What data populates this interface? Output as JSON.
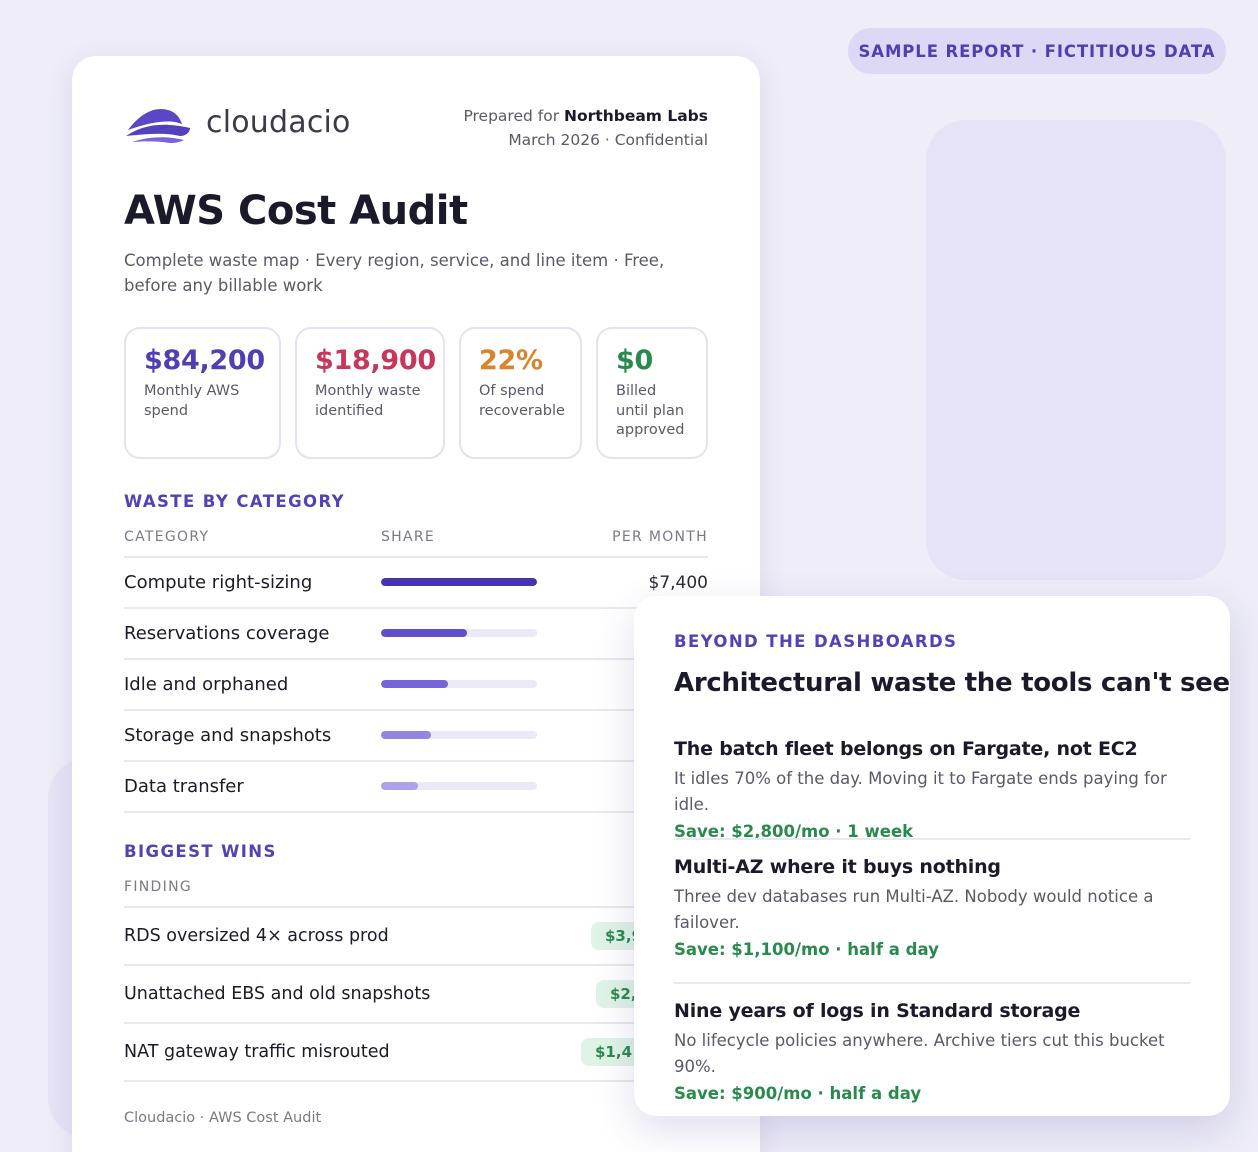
{
  "badge": {
    "label": "SAMPLE REPORT · FICTITIOUS DATA"
  },
  "brand": {
    "name": "cloudacio",
    "logo_icon": "cloudacio-wave-logo"
  },
  "prepared": {
    "prefix": "Prepared for",
    "client": "Northbeam Labs",
    "line2": "March 2026 · Confidential"
  },
  "report": {
    "title": "AWS Cost Audit",
    "subtitle": "Complete waste map · Every region, service, and line item · Free, before any billable work"
  },
  "stats": [
    {
      "value": "$84,200",
      "label": "Monthly AWS spend",
      "color": "#4f3fb3"
    },
    {
      "value": "$18,900",
      "label": "Monthly waste identified",
      "color": "#c8365b"
    },
    {
      "value": "22%",
      "label": "Of spend recoverable",
      "color": "#d9842a"
    },
    {
      "value": "$0",
      "label": "Billed until plan approved",
      "color": "#2a8a4e"
    }
  ],
  "waste": {
    "heading": "WASTE BY CATEGORY",
    "columns": [
      "CATEGORY",
      "SHARE",
      "PER MONTH"
    ],
    "rows": [
      {
        "label": "Compute right-sizing",
        "share": 1.0,
        "value": "$7,400"
      },
      {
        "label": "Reservations coverage",
        "share": 0.55,
        "value": ""
      },
      {
        "label": "Idle and orphaned",
        "share": 0.43,
        "value": ""
      },
      {
        "label": "Storage and snapshots",
        "share": 0.32,
        "value": ""
      },
      {
        "label": "Data transfer",
        "share": 0.24,
        "value": ""
      }
    ],
    "bar_colors": [
      "#4536b0",
      "#5f4fc8",
      "#7565d6",
      "#9485e2",
      "#ada1ea"
    ]
  },
  "wins": {
    "heading": "BIGGEST WINS",
    "column": "FINDING",
    "rows": [
      {
        "label": "RDS oversized 4× across prod",
        "chip": "$3,9"
      },
      {
        "label": "Unattached EBS and old snapshots",
        "chip": "$2,"
      },
      {
        "label": "NAT gateway traffic misrouted",
        "chip": "$1,4"
      }
    ]
  },
  "footer": "Cloudacio · AWS Cost Audit",
  "beyond": {
    "eyebrow": "BEYOND THE DASHBOARDS",
    "title": "Architectural waste the tools can't see",
    "items": [
      {
        "title": "The batch fleet belongs on Fargate, not EC2",
        "body": "It idles 70% of the day. Moving it to Fargate ends paying for idle.",
        "save": "Save: $2,800/mo · 1 week"
      },
      {
        "title": "Multi-AZ where it buys nothing",
        "body": "Three dev databases run Multi-AZ. Nobody would notice a failover.",
        "save": "Save: $1,100/mo · half a day"
      },
      {
        "title": "Nine years of logs in Standard storage",
        "body": "No lifecycle policies anywhere. Archive tiers cut this bucket 90%.",
        "save": "Save: $900/mo · half a day"
      }
    ]
  }
}
